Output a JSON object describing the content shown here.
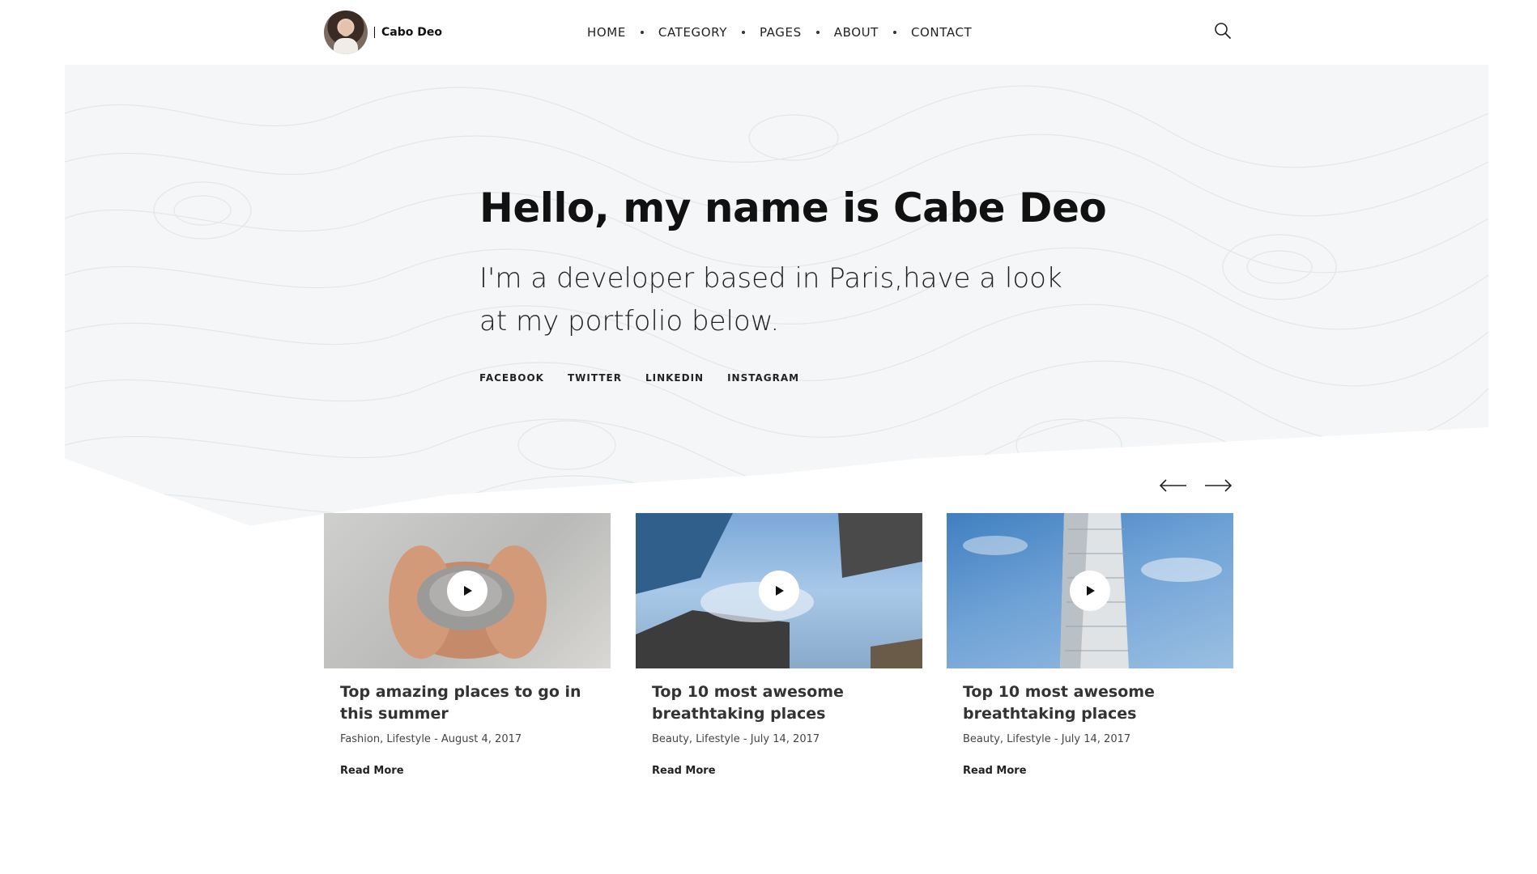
{
  "brand": {
    "name": "Cabo Deo"
  },
  "nav": {
    "items": [
      "HOME",
      "CATEGORY",
      "PAGES",
      "ABOUT",
      "CONTACT"
    ]
  },
  "hero": {
    "title": "Hello, my name is Cabe Deo",
    "subtitle": "I'm a developer based in Paris,have a look at my portfolio below.",
    "socials": [
      "FACEBOOK",
      "TWITTER",
      "LINKEDIN",
      "INSTAGRAM"
    ]
  },
  "posts": [
    {
      "title": "Top amazing places to go in this summer",
      "meta": "Fashion, Lifestyle - August 4, 2017",
      "read_more": "Read More"
    },
    {
      "title": "Top 10 most awesome breathtaking places",
      "meta": "Beauty, Lifestyle - July 14, 2017",
      "read_more": "Read More"
    },
    {
      "title": "Top 10 most awesome breathtaking places",
      "meta": "Beauty, Lifestyle - July 14, 2017",
      "read_more": "Read More"
    }
  ],
  "colors": {
    "hero_bg": "#f4f6f7",
    "text_dark": "#111111"
  }
}
